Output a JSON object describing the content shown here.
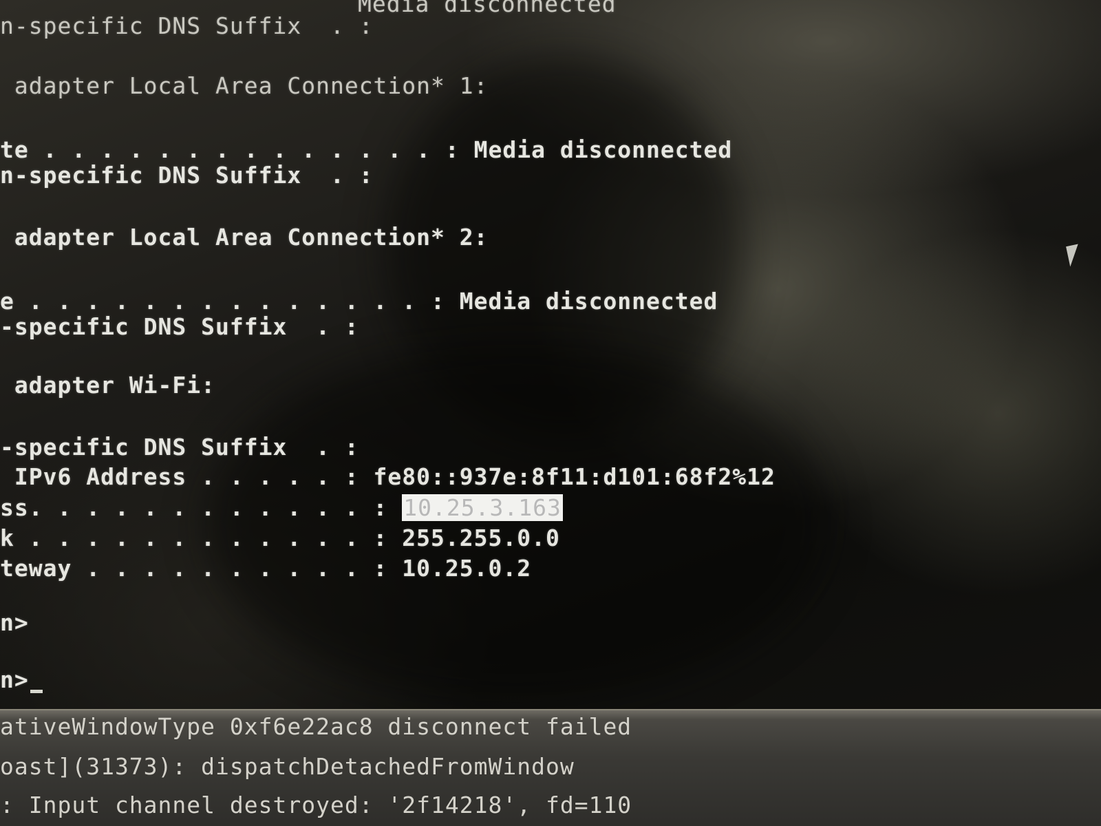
{
  "terminal": {
    "lines": [
      "n-specific DNS Suffix  . :",
      " adapter Local Area Connection* 1:",
      "te . . . . . . . . . . . . . . : Media disconnected",
      "n-specific DNS Suffix  . :",
      " adapter Local Area Connection* 2:",
      "e . . . . . . . . . . . . . . : Media disconnected",
      "-specific DNS Suffix  . :",
      " adapter Wi-Fi:",
      "-specific DNS Suffix  . :",
      " IPv6 Address . . . . . : fe80::937e:8f11:d101:68f2%12",
      "ss. . . . . . . . . . . . : ",
      "k . . . . . . . . . . . . : 255.255.0.0",
      "teway . . . . . . . . . . : 10.25.0.2",
      "n>",
      "n>"
    ],
    "top_partial_line": "Media disconnected",
    "selected_ip": "10.25.3.163"
  },
  "log": {
    "lines": [
      "ativeWindowType 0xf6e22ac8 disconnect failed",
      "oast](31373): dispatchDetachedFromWindow",
      ": Input channel destroyed: '2f14218', fd=110"
    ]
  },
  "colors": {
    "terminal_text": "#e6e6e0",
    "selection_bg": "#f2f2ef",
    "bezel": "#3a3935"
  }
}
